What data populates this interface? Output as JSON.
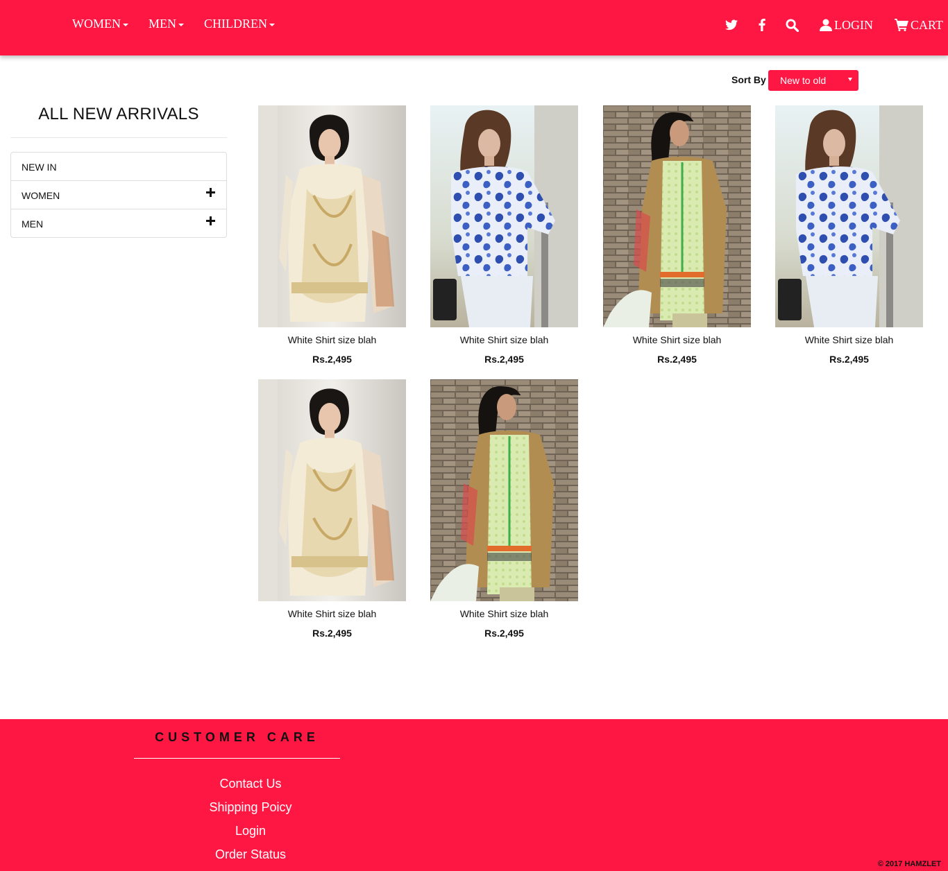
{
  "nav": {
    "items": [
      {
        "label": "WOMEN"
      },
      {
        "label": "MEN"
      },
      {
        "label": "CHILDREN"
      }
    ],
    "login_label": "LOGIN",
    "cart_label": "CART",
    "icons": [
      "twitter-icon",
      "facebook-icon",
      "search-icon",
      "user-icon",
      "cart-icon"
    ]
  },
  "sort": {
    "label": "Sort By",
    "selected": "New to old"
  },
  "sidebar": {
    "title": "ALL NEW ARRIVALS",
    "items": [
      {
        "label": "NEW IN"
      },
      {
        "label": "WOMEN"
      },
      {
        "label": "MEN"
      }
    ]
  },
  "products": [
    {
      "name": "White Shirt size blah",
      "price": "Rs.2,495",
      "image": "model in cream embroidered shirt"
    },
    {
      "name": "White Shirt size blah",
      "price": "Rs.2,495",
      "image": "model in blue floral shirt"
    },
    {
      "name": "White Shirt size blah",
      "price": "Rs.2,495",
      "image": "model in green printed kurta"
    },
    {
      "name": "White Shirt size blah",
      "price": "Rs.2,495",
      "image": "model in blue floral shirt"
    },
    {
      "name": "White Shirt size blah",
      "price": "Rs.2,495",
      "image": "model in cream embroidered shirt"
    },
    {
      "name": "White Shirt size blah",
      "price": "Rs.2,495",
      "image": "model in green printed kurta"
    }
  ],
  "footer": {
    "care_title": "CUSTOMER CARE",
    "links": [
      {
        "label": "Contact Us"
      },
      {
        "label": "Shipping Poicy"
      },
      {
        "label": "Login"
      },
      {
        "label": "Order Status"
      }
    ],
    "copyright": "© 2017 HAMZLET"
  },
  "colors": {
    "brand": "#ff1744",
    "text": "#111111"
  }
}
